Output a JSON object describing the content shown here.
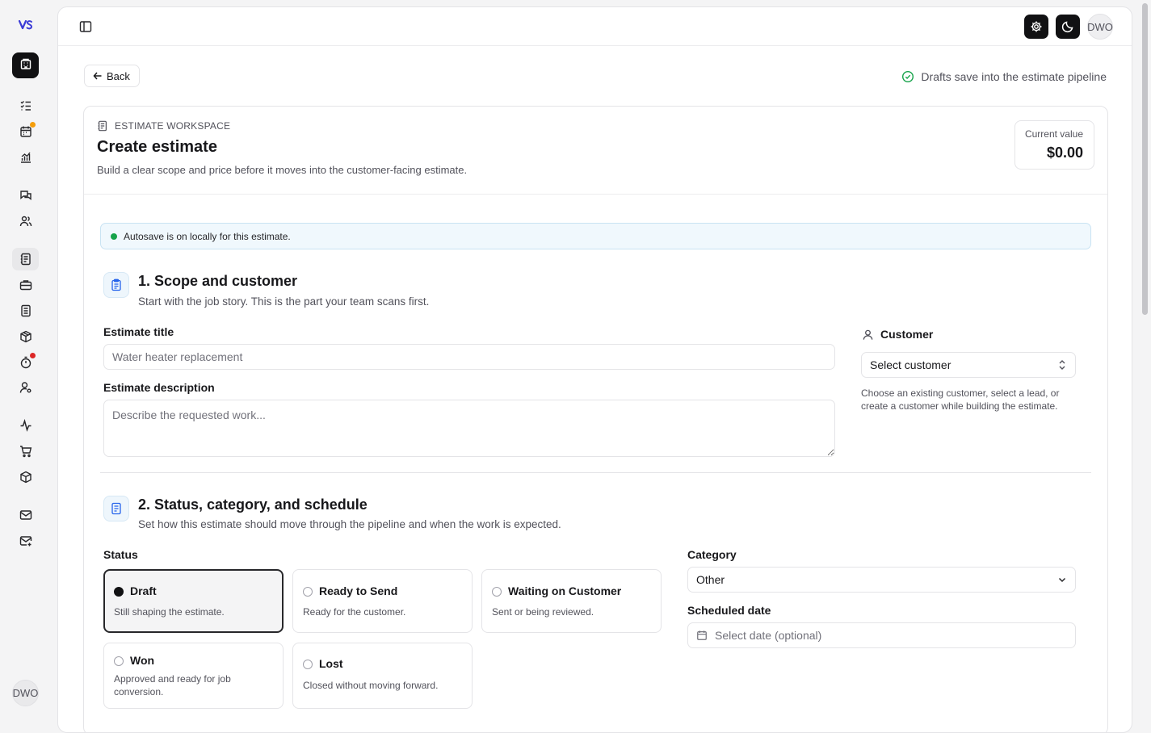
{
  "rail": {
    "avatar": "DWO"
  },
  "topbar": {
    "avatar": "DWO"
  },
  "page": {
    "back_label": "Back",
    "pipeline_note": "Drafts save into the estimate pipeline"
  },
  "header": {
    "eyebrow": "ESTIMATE WORKSPACE",
    "title": "Create estimate",
    "subtitle": "Build a clear scope and price before it moves into the customer-facing estimate.",
    "value_label": "Current value",
    "value": "$0.00"
  },
  "autosave": "Autosave is on locally for this estimate.",
  "section1": {
    "title": "1. Scope and customer",
    "subtitle": "Start with the job story. This is the part your team scans first.",
    "title_label": "Estimate title",
    "title_placeholder": "Water heater replacement",
    "description_label": "Estimate description",
    "description_placeholder": "Describe the requested work...",
    "customer_label": "Customer",
    "customer_select": "Select customer",
    "customer_help": "Choose an existing customer, select a lead, or create a customer while building the estimate."
  },
  "section2": {
    "title": "2. Status, category, and schedule",
    "subtitle": "Set how this estimate should move through the pipeline and when the work is expected.",
    "status_label": "Status",
    "statuses": [
      {
        "title": "Draft",
        "desc": "Still shaping the estimate.",
        "selected": true
      },
      {
        "title": "Ready to Send",
        "desc": "Ready for the customer.",
        "selected": false
      },
      {
        "title": "Waiting on Customer",
        "desc": "Sent or being reviewed.",
        "selected": false
      },
      {
        "title": "Won",
        "desc": "Approved and ready for job conversion.",
        "selected": false
      },
      {
        "title": "Lost",
        "desc": "Closed without moving forward.",
        "selected": false
      }
    ],
    "category_label": "Category",
    "category_value": "Other",
    "date_label": "Scheduled date",
    "date_placeholder": "Select date (optional)"
  },
  "colors": {
    "accent_dark": "#111113",
    "notify_orange": "#f59e0b",
    "notify_red": "#dc2626",
    "success_green": "#16a34a",
    "info_bg": "#f0f8fd"
  }
}
